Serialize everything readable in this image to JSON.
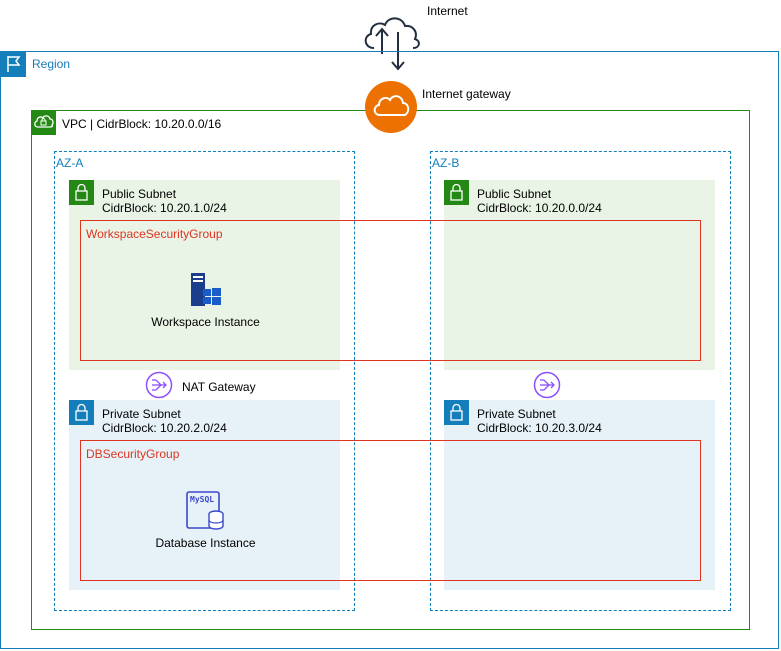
{
  "internet": {
    "label": "Internet"
  },
  "internet_gateway": {
    "label": "Internet gateway"
  },
  "region": {
    "label": "Region"
  },
  "vpc": {
    "label": "VPC | CidrBlock: 10.20.0.0/16"
  },
  "az_a": {
    "label": "AZ-A",
    "public_subnet": {
      "name": "Public Subnet",
      "cidr": "CidrBlock: 10.20.1.0/24"
    },
    "private_subnet": {
      "name": "Private Subnet",
      "cidr": "CidrBlock: 10.20.2.0/24"
    }
  },
  "az_b": {
    "label": "AZ-B",
    "public_subnet": {
      "name": "Public Subnet",
      "cidr": "CidrBlock: 10.20.0.0/24"
    },
    "private_subnet": {
      "name": "Private Subnet",
      "cidr": "CidrBlock: 10.20.3.0/24"
    }
  },
  "workspace_sg": {
    "label": "WorkspaceSecurityGroup"
  },
  "db_sg": {
    "label": "DBSecurityGroup"
  },
  "workspace_instance": {
    "label": "Workspace Instance"
  },
  "database_instance": {
    "label": "Database Instance",
    "icon_text": "MySQL"
  },
  "nat_gateway": {
    "label": "NAT Gateway"
  },
  "colors": {
    "region": "#147EBA",
    "vpc": "#248814",
    "public_subnet_bg": "#E9F3E6",
    "private_subnet_bg": "#E6F2F8",
    "security_group": "#DD3522",
    "internet_gateway": "#ED7100",
    "nat_gateway": "#8C4FFF"
  }
}
